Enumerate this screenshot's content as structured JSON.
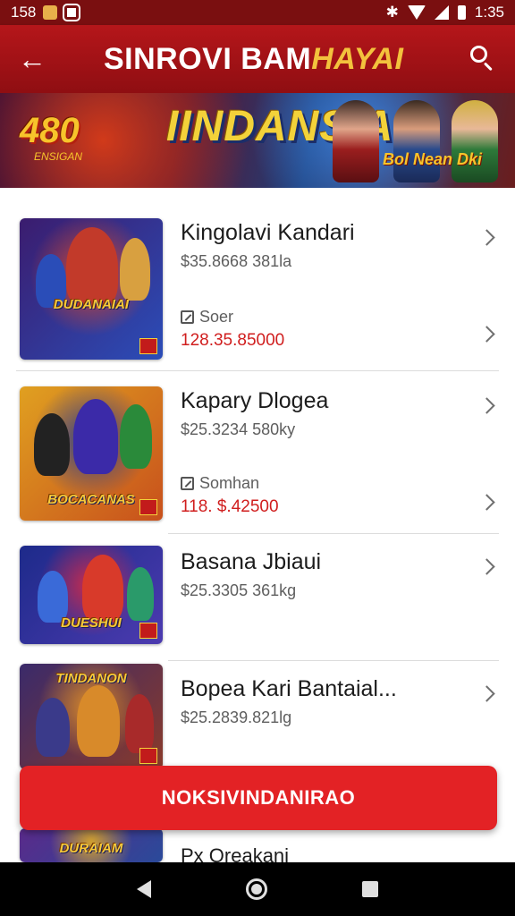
{
  "status_bar": {
    "time_left": "158",
    "time_right": "1:35"
  },
  "app_bar": {
    "title_main": "SINROVI BAM",
    "title_highlight": "HAYAI"
  },
  "banner": {
    "number": "480",
    "subtitle": "ENSIGAN",
    "title": "IINDANSIA",
    "tag": "Bol Nean Dki"
  },
  "items": [
    {
      "name": "Kingolavi Kandari",
      "meta": "$35.8668 381la",
      "sub_label": "Soer",
      "price": "128.35.85000",
      "thumb_title": "DUDANAIAI",
      "thumb_colors": [
        "#3b1c6e",
        "#2b4db8",
        "#d9452a"
      ]
    },
    {
      "name": "Kapary Dlogea",
      "meta": "$25.3234 580ky",
      "sub_label": "Somhan",
      "price": "118. $.42500",
      "thumb_title": "BOCACANAS",
      "thumb_colors": [
        "#e0a020",
        "#c8501c",
        "#2a3f8e"
      ]
    },
    {
      "name": "Basana Jbiaui",
      "meta": "$25.3305 361kg",
      "thumb_title": "DUESHUI",
      "thumb_colors": [
        "#1d2a8a",
        "#4c3bb0",
        "#c92a4a"
      ]
    },
    {
      "name": "Bopea Kari Bantaial...",
      "meta": "$25.2839.821lg",
      "thumb_title": "TINDANON",
      "thumb_colors": [
        "#3a2a6a",
        "#8a3a2a",
        "#d88a2a"
      ]
    },
    {
      "name": "Px Oreakani",
      "thumb_title": "DURAIAM",
      "thumb_colors": [
        "#5a2a8a",
        "#2a4a9a",
        "#d0a030"
      ]
    }
  ],
  "action_button": {
    "label": "NOKSIVINDANIRAO"
  }
}
